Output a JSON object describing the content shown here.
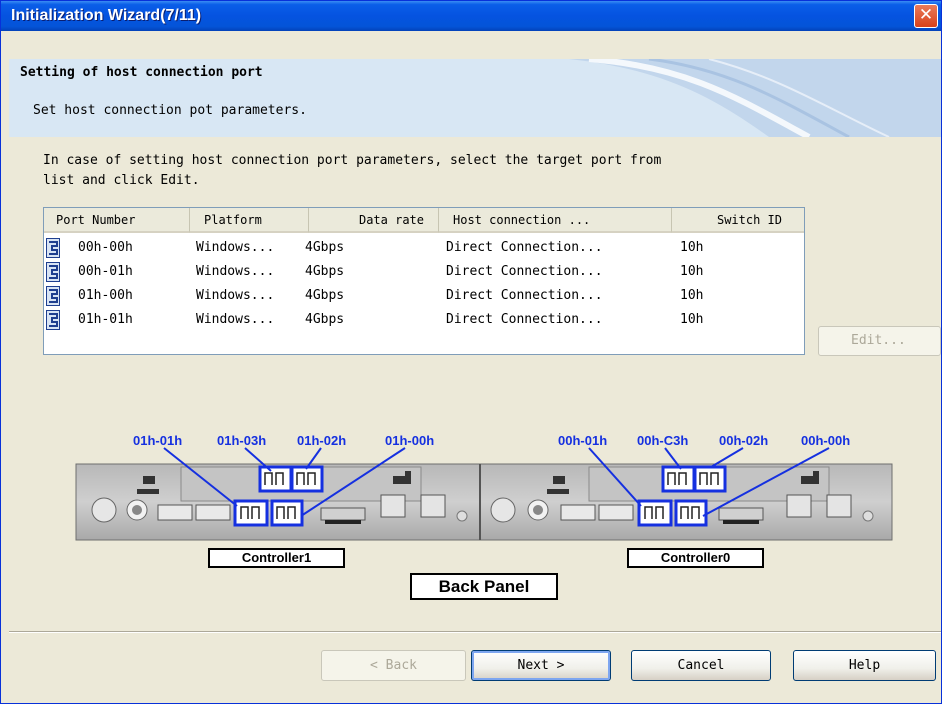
{
  "window": {
    "title": "Initialization Wizard(7/11)",
    "close_symbol": "✕"
  },
  "banner": {
    "title": "Setting of host connection port",
    "description": "Set host connection pot parameters."
  },
  "instructions": {
    "line1": "In case of setting host connection port parameters, select the target port from",
    "line2": "list and click Edit."
  },
  "table": {
    "columns": [
      "Port Number",
      "Platform",
      "Data rate",
      "Host connection ...",
      "Switch ID"
    ],
    "rows": [
      [
        "00h-00h",
        "Windows...",
        "4Gbps",
        "Direct Connection...",
        "10h"
      ],
      [
        "00h-01h",
        "Windows...",
        "4Gbps",
        "Direct Connection...",
        "10h"
      ],
      [
        "01h-00h",
        "Windows...",
        "4Gbps",
        "Direct Connection...",
        "10h"
      ],
      [
        "01h-01h",
        "Windows...",
        "4Gbps",
        "Direct Connection...",
        "10h"
      ]
    ],
    "row_icon": "port-icon"
  },
  "edit_button": {
    "label": "Edit..."
  },
  "diagram": {
    "controller1_ports": [
      "01h-01h",
      "01h-03h",
      "01h-02h",
      "01h-00h"
    ],
    "controller0_ports": [
      "00h-01h",
      "00h-C3h",
      "00h-02h",
      "00h-00h"
    ],
    "controller1_label": "Controller1",
    "controller0_label": "Controller0",
    "back_panel_label": "Back Panel",
    "label_color": "#1530e0"
  },
  "buttons": {
    "back": "< Back",
    "next": "Next >",
    "cancel": "Cancel",
    "help": "Help"
  },
  "colors": {
    "titlebar": "#0553e0",
    "dialog_bg": "#ece9d8",
    "banner_bg": "#d8e7f4"
  }
}
